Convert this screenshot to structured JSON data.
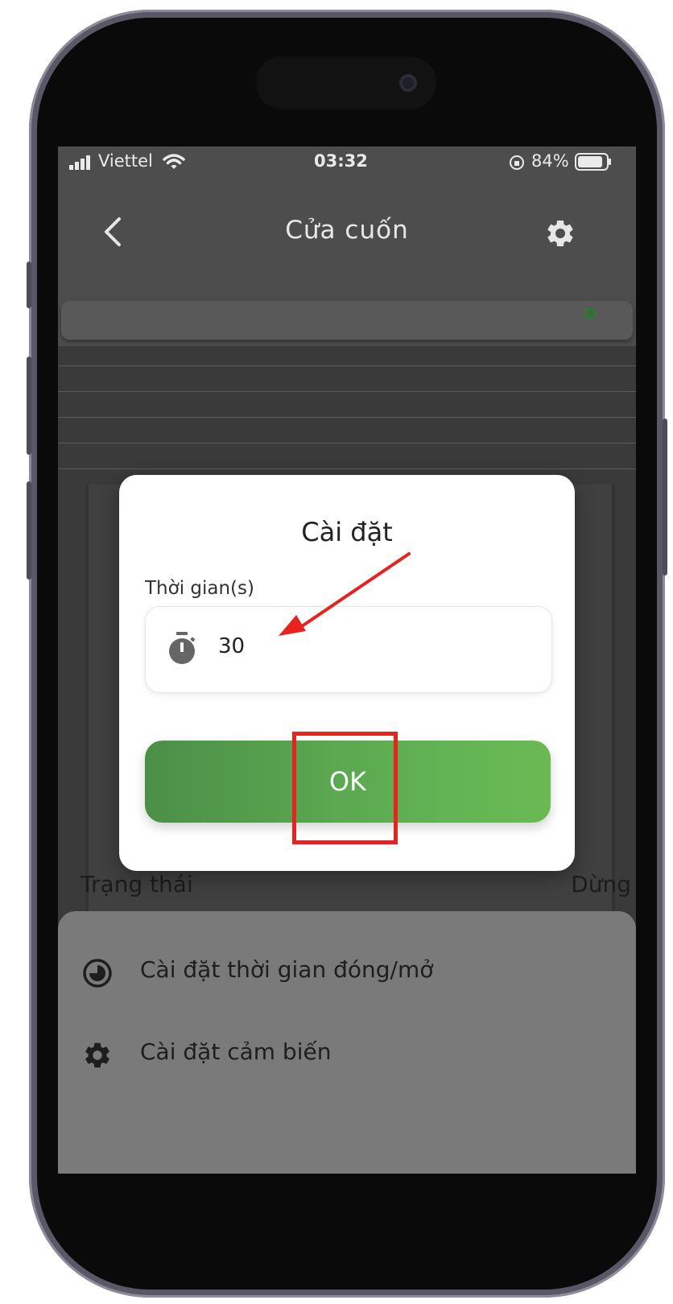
{
  "status_bar": {
    "carrier": "Viettel",
    "time": "03:32",
    "battery": "84%"
  },
  "header": {
    "title": "Cửa cuốn",
    "back_icon": "chevron-left-icon",
    "settings_icon": "gear-icon"
  },
  "device": {
    "online_indicator_color": "#2e7d32"
  },
  "status_row": {
    "label": "Trạng thái",
    "value": "Dừng"
  },
  "bottom_sheet": {
    "items": [
      {
        "label": "Cài đặt thời gian đóng/mở",
        "icon": "clock-icon"
      },
      {
        "label": "Cài đặt cảm biến",
        "icon": "gear-icon"
      }
    ]
  },
  "dialog": {
    "title": "Cài đặt",
    "field_label": "Thời gian(s)",
    "field_value": "30",
    "field_icon": "stopwatch-icon",
    "ok_label": "OK"
  },
  "annotation": {
    "color": "#e8231f"
  }
}
